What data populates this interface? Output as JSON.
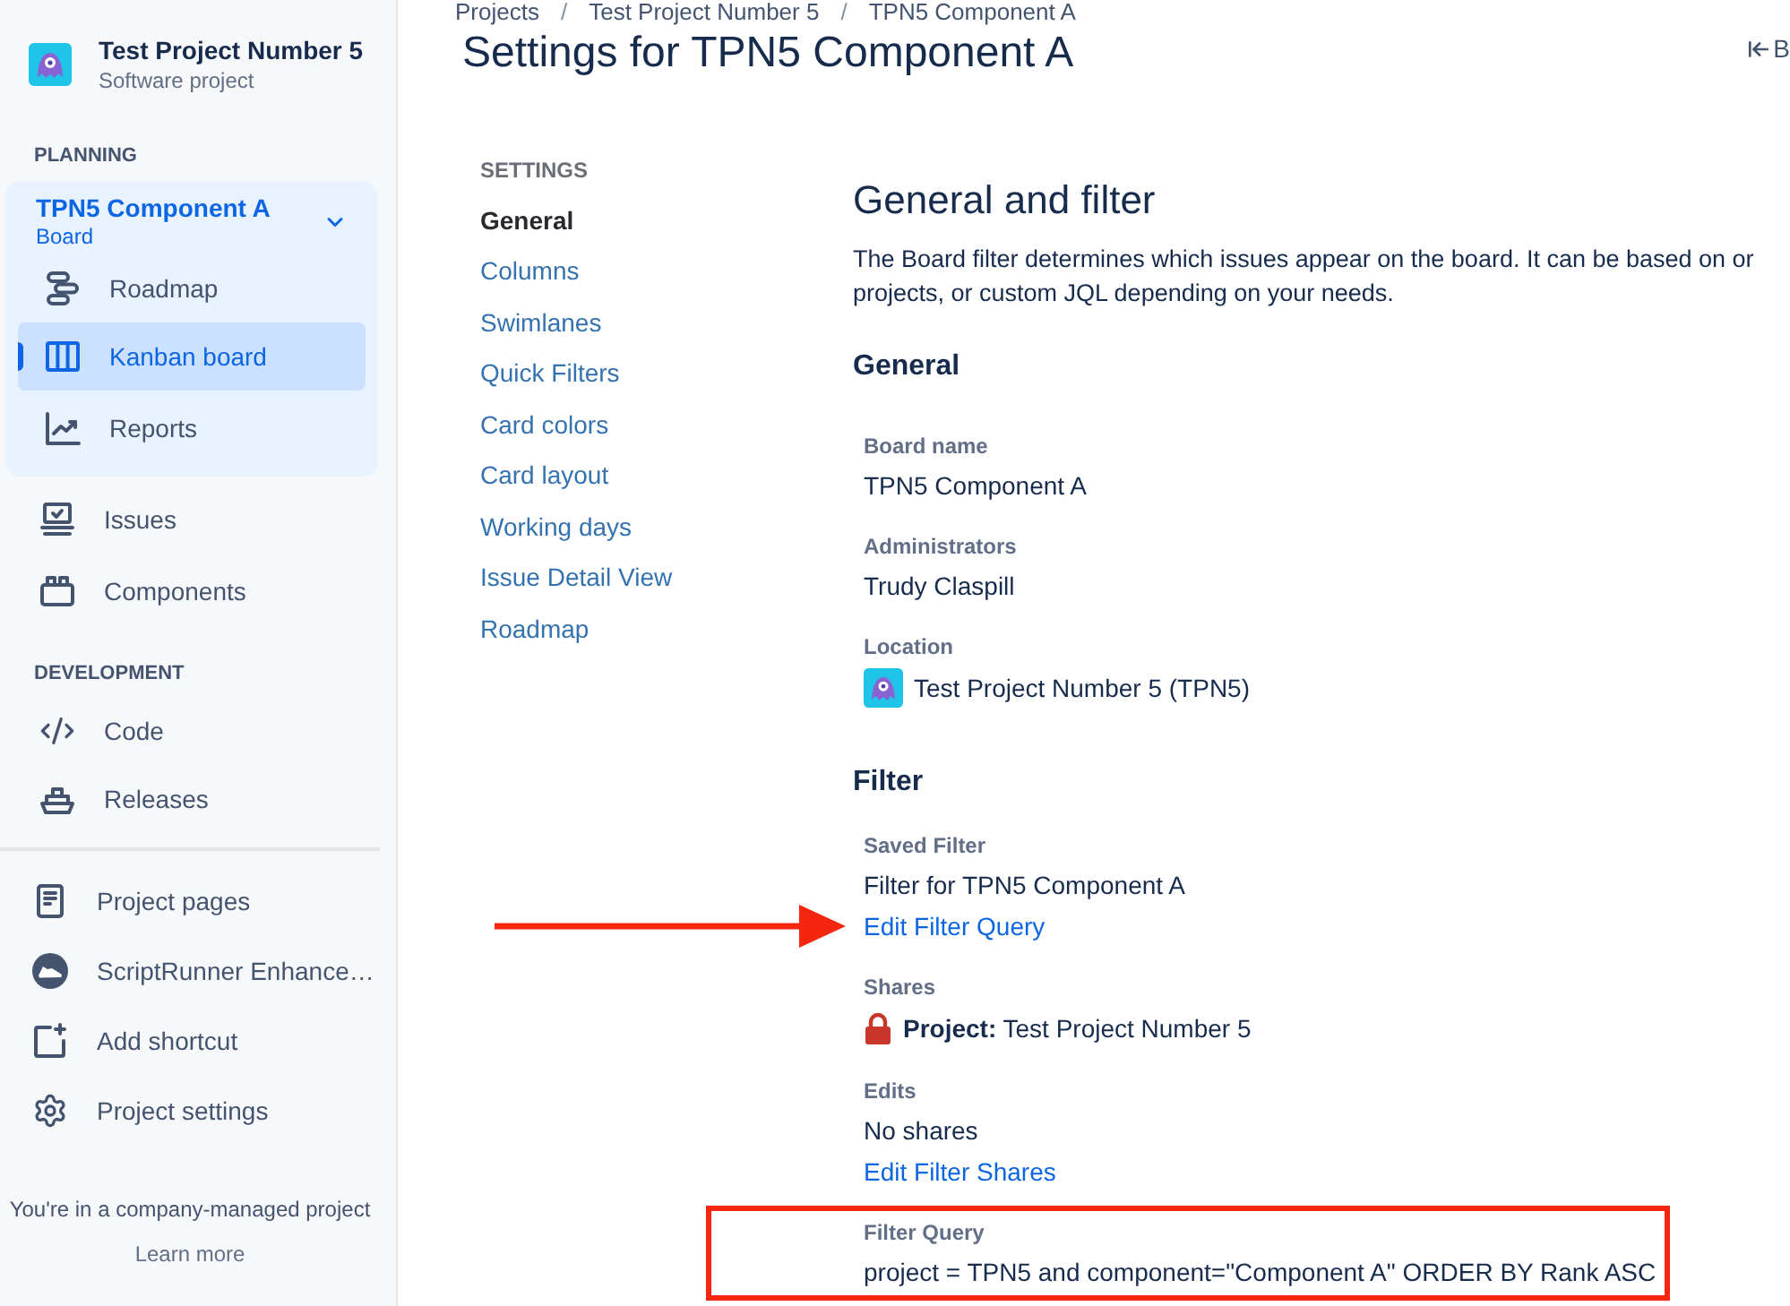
{
  "sidebar": {
    "project": {
      "name": "Test Project Number 5",
      "type": "Software project"
    },
    "groups": [
      {
        "heading": "PLANNING",
        "board": {
          "name": "TPN5 Component A",
          "type": "Board",
          "expanded": true,
          "items": [
            {
              "label": "Roadmap",
              "selected": false
            },
            {
              "label": "Kanban board",
              "selected": true
            },
            {
              "label": "Reports",
              "selected": false
            }
          ]
        },
        "items": [
          {
            "label": "Issues",
            "selected": false
          },
          {
            "label": "Components",
            "selected": false
          }
        ]
      },
      {
        "heading": "DEVELOPMENT",
        "items": [
          {
            "label": "Code",
            "selected": false
          },
          {
            "label": "Releases",
            "selected": false
          }
        ]
      }
    ],
    "shortcuts": [
      {
        "label": "Project pages",
        "selected": false
      },
      {
        "label": "ScriptRunner Enhance…",
        "selected": false
      },
      {
        "label": "Add shortcut",
        "selected": false
      },
      {
        "label": "Project settings",
        "selected": false
      }
    ],
    "footer": {
      "text": "You're in a company-managed project",
      "link": "Learn more"
    }
  },
  "breadcrumbs": [
    {
      "kind": "link",
      "text": "Projects"
    },
    {
      "kind": "separator",
      "text": "/"
    },
    {
      "kind": "link",
      "text": "Test Project Number 5"
    },
    {
      "kind": "separator",
      "text": "/"
    },
    {
      "kind": "link",
      "text": "TPN5 Component A"
    }
  ],
  "page_title": "Settings for TPN5 Component A",
  "back_button": {
    "label": "B"
  },
  "settings_nav": {
    "heading": "SETTINGS",
    "items": [
      {
        "label": "General",
        "selected": true
      },
      {
        "label": "Columns",
        "selected": false
      },
      {
        "label": "Swimlanes",
        "selected": false
      },
      {
        "label": "Quick Filters",
        "selected": false
      },
      {
        "label": "Card colors",
        "selected": false
      },
      {
        "label": "Card layout",
        "selected": false
      },
      {
        "label": "Working days",
        "selected": false
      },
      {
        "label": "Issue Detail View",
        "selected": false
      },
      {
        "label": "Roadmap",
        "selected": false
      }
    ]
  },
  "content": {
    "title": "General and filter",
    "description": [
      "The Board filter determines which issues appear on the board. It can be based on or",
      "projects, or custom JQL depending on your needs."
    ],
    "sections": [
      {
        "heading": "General",
        "fields": [
          {
            "kind": "text",
            "label": "Board name",
            "value": "TPN5 Component A"
          },
          {
            "kind": "text",
            "label": "Administrators",
            "value": "Trudy Claspill"
          },
          {
            "kind": "project",
            "label": "Location",
            "value": "Test Project Number 5 (TPN5)"
          }
        ]
      },
      {
        "heading": "Filter",
        "fields": [
          {
            "kind": "text",
            "label": "Saved Filter",
            "value": "Filter for TPN5 Component A",
            "link": "Edit Filter Query",
            "arrow_marked": true
          },
          {
            "kind": "share",
            "label": "Shares",
            "value": "**Project:** Test Project Number 5"
          },
          {
            "kind": "text",
            "label": "Edits",
            "value": "No shares",
            "link": "Edit Filter Shares"
          },
          {
            "kind": "text",
            "label": "Filter Query",
            "value": "project = TPN5 and component=\"Component A\" ORDER BY Rank ASC",
            "framed": true
          }
        ]
      }
    ]
  }
}
